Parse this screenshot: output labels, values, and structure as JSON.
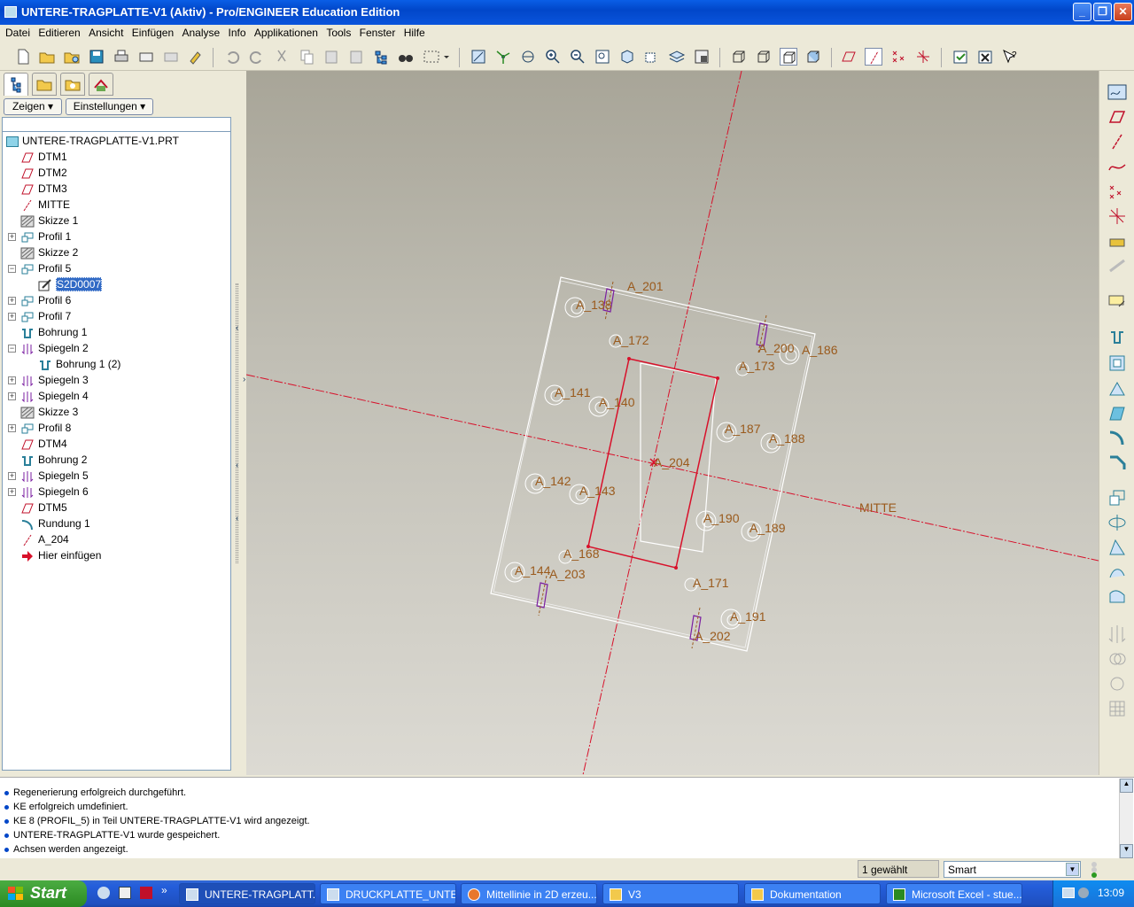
{
  "window": {
    "title": "UNTERE-TRAGPLATTE-V1 (Aktiv) - Pro/ENGINEER Education Edition"
  },
  "menu": [
    "Datei",
    "Editieren",
    "Ansicht",
    "Einfügen",
    "Analyse",
    "Info",
    "Applikationen",
    "Tools",
    "Fenster",
    "Hilfe"
  ],
  "panel": {
    "show_label": "Zeigen",
    "settings_label": "Einstellungen"
  },
  "tree": {
    "root": "UNTERE-TRAGPLATTE-V1.PRT",
    "items": [
      {
        "label": "DTM1",
        "icon": "datum-plane-icon"
      },
      {
        "label": "DTM2",
        "icon": "datum-plane-icon"
      },
      {
        "label": "DTM3",
        "icon": "datum-plane-icon"
      },
      {
        "label": "MITTE",
        "icon": "datum-axis-icon"
      },
      {
        "label": "Skizze 1",
        "icon": "sketch-icon"
      },
      {
        "label": "Profil 1",
        "icon": "extrude-icon"
      },
      {
        "label": "Skizze 2",
        "icon": "sketch-icon"
      },
      {
        "label": "Profil 5",
        "icon": "extrude-icon"
      },
      {
        "label": "S2D0007",
        "icon": "section-icon"
      },
      {
        "label": "Profil 6",
        "icon": "extrude-icon"
      },
      {
        "label": "Profil 7",
        "icon": "extrude-icon"
      },
      {
        "label": "Bohrung 1",
        "icon": "hole-icon"
      },
      {
        "label": "Spiegeln 2",
        "icon": "mirror-icon"
      },
      {
        "label": "Bohrung 1 (2)",
        "icon": "hole-icon"
      },
      {
        "label": "Spiegeln 3",
        "icon": "mirror-icon"
      },
      {
        "label": "Spiegeln 4",
        "icon": "mirror-icon"
      },
      {
        "label": "Skizze 3",
        "icon": "sketch-icon"
      },
      {
        "label": "Profil 8",
        "icon": "extrude-icon"
      },
      {
        "label": "DTM4",
        "icon": "datum-plane-icon"
      },
      {
        "label": "Bohrung 2",
        "icon": "hole-icon"
      },
      {
        "label": "Spiegeln 5",
        "icon": "mirror-icon"
      },
      {
        "label": "Spiegeln 6",
        "icon": "mirror-icon"
      },
      {
        "label": "DTM5",
        "icon": "datum-plane-icon"
      },
      {
        "label": "Rundung 1",
        "icon": "round-icon"
      },
      {
        "label": "A_204",
        "icon": "datum-axis-icon"
      },
      {
        "label": "Hier einfügen",
        "icon": "insert-here-icon"
      }
    ]
  },
  "viewport": {
    "axis_labels": [
      "A_201",
      "A_138",
      "A_172",
      "A_200",
      "A_186",
      "A_173",
      "A_141",
      "A_140",
      "A_187",
      "A_188",
      "A_204",
      "A_142",
      "A_143",
      "A_190",
      "A_189",
      "A_168",
      "A_144",
      "A_203",
      "A_171",
      "A_191",
      "A_202"
    ],
    "axis_mitte": "MITTE"
  },
  "messages": [
    "Regenerierung erfolgreich durchgeführt.",
    "KE erfolgreich umdefiniert.",
    "KE 8 (PROFIL_5) in Teil UNTERE-TRAGPLATTE-V1 wird angezeigt.",
    "UNTERE-TRAGPLATTE-V1 wurde gespeichert.",
    "Achsen werden angezeigt."
  ],
  "status": {
    "selected": "1 gewählt",
    "filter": "Smart"
  },
  "taskbar": {
    "start": "Start",
    "tasks": [
      "UNTERE-TRAGPLATT...",
      "DRUCKPLATTE_UNTE...",
      "Mittellinie in 2D erzeu...",
      "V3",
      "Dokumentation",
      "Microsoft Excel - stue..."
    ],
    "clock": "13:09"
  },
  "colors": {
    "datum": "#d8102a",
    "axis_label": "#9a5a1c",
    "edge": "#ffffff",
    "sketch": "#7b1fa2"
  }
}
